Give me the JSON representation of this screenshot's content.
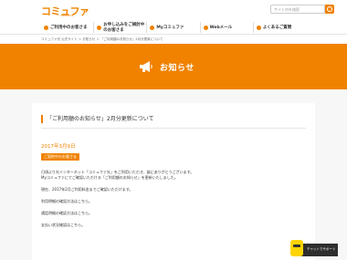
{
  "header": {
    "logo": "コミュファ",
    "logo_sub": "commufa",
    "search_placeholder": "サイト内を検索"
  },
  "nav": {
    "items": [
      {
        "label": "ご利用中のお客さま"
      },
      {
        "label": "お申し込みをご検討中のお客さま"
      },
      {
        "label": "Myコミュファ"
      },
      {
        "label": "Webメール"
      },
      {
        "label": "よくあるご質問"
      }
    ]
  },
  "breadcrumb": "コミュファ光 公式サイト ＞ お知らせ ＞ 「ご利用額のお知らせ」2月分更新について",
  "banner": {
    "title": "お知らせ"
  },
  "article": {
    "title": "「ご利用額のお知らせ」2月分更新について",
    "date": "2017年3月9日",
    "tag": "ご契約中のお客さま",
    "paragraphs": [
      "日頃より光インターネット「コミュファ光」をご利用いただき、誠にありがとうございます。",
      "Myコミュファにてご確認いただける「ご利用額のお知らせ」を更新いたしました。",
      "",
      "現在、2017年2月ご利用料金までご確認いただけます。",
      "",
      "利用明細の確認方法はこちら。",
      "",
      "通話明細の確認方法はこちら。",
      "",
      "支払い状況確認はこちら。"
    ]
  },
  "chat": {
    "label": "チャットでサポート"
  },
  "colors": {
    "brand": "#f08200",
    "background": "#f7f7f7"
  }
}
